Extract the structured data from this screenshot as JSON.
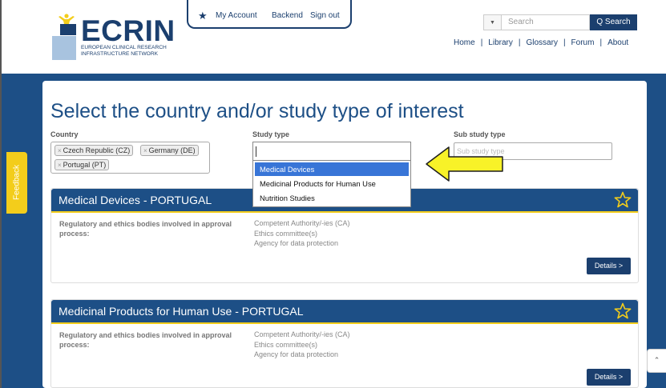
{
  "brand": {
    "name": "ECRIN",
    "subtitle_line1": "EUROPEAN CLINICAL RESEARCH",
    "subtitle_line2": "INFRASTRUCTURE NETWORK",
    "navy": "#1b3f6e",
    "light_blue": "#a8c3df"
  },
  "account_menu": {
    "icon": "star-icon",
    "my_account": "My Account",
    "backend": "Backend",
    "sign_out": "Sign out"
  },
  "search": {
    "placeholder": "Search",
    "button_label": "Q Search"
  },
  "nav": {
    "home": "Home",
    "library": "Library",
    "glossary": "Glossary",
    "forum": "Forum",
    "about": "About"
  },
  "feedback": {
    "label": "Feedback",
    "color": "#f3cd1b"
  },
  "page": {
    "title": "Select the country and/or study type of interest",
    "band_color": "#1d4f86"
  },
  "filters": {
    "country": {
      "label": "Country",
      "selected": [
        "Czech Republic (CZ)",
        "Germany (DE)",
        "Portugal (PT)"
      ]
    },
    "study_type": {
      "label": "Study type",
      "value": "",
      "options": [
        "Medical Devices",
        "Medicinal Products for Human Use",
        "Nutrition Studies"
      ],
      "highlighted": "Medical Devices"
    },
    "sub_study_type": {
      "label": "Sub study type",
      "placeholder": "Sub study type"
    }
  },
  "cards": [
    {
      "title": "Medical Devices - PORTUGAL",
      "label": "Regulatory and ethics bodies involved in approval process:",
      "values": [
        "Competent Authority/-ies (CA)",
        "Ethics committee(s)",
        "Agency for data protection"
      ],
      "details_label": "Details >"
    },
    {
      "title": "Medicinal Products for Human Use - PORTUGAL",
      "label": "Regulatory and ethics bodies involved in approval process:",
      "values": [
        "Competent Authority/-ies (CA)",
        "Ethics committee(s)",
        "Agency for data protection"
      ],
      "details_label": "Details >"
    }
  ],
  "annotation": {
    "icon": "yellow-arrow-icon",
    "color": "#f8f228"
  },
  "scroll_top": {
    "label": "⌃"
  }
}
